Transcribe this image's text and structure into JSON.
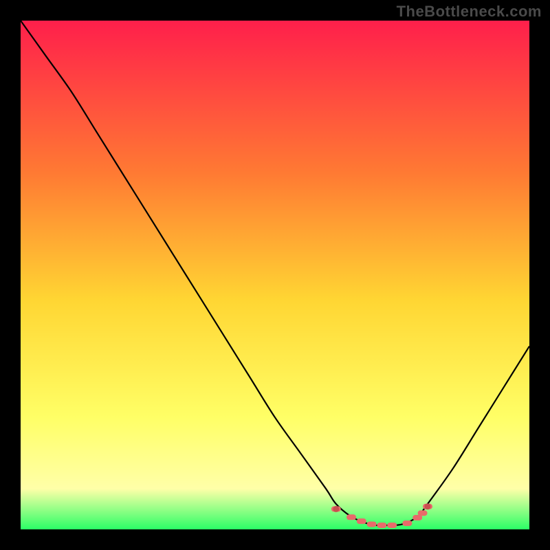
{
  "watermark": "TheBottleneck.com",
  "colors": {
    "frame": "#000000",
    "curve": "#000000",
    "markers": "#e86a6a",
    "grad_top": "#ff1f4b",
    "grad_mid1": "#ff7a33",
    "grad_mid2": "#ffd633",
    "grad_mid3": "#ffff66",
    "grad_low": "#ffffa8",
    "grad_bottom": "#2bff66"
  },
  "chart_data": {
    "type": "line",
    "title": "",
    "xlabel": "",
    "ylabel": "",
    "xlim": [
      0,
      100
    ],
    "ylim": [
      0,
      100
    ],
    "curve": {
      "x": [
        0,
        5,
        10,
        15,
        20,
        25,
        30,
        35,
        40,
        45,
        50,
        55,
        60,
        62,
        65,
        68,
        70,
        72,
        75,
        78,
        80,
        85,
        90,
        95,
        100
      ],
      "y": [
        100,
        93,
        86,
        78,
        70,
        62,
        54,
        46,
        38,
        30,
        22,
        15,
        8,
        5,
        2.5,
        1.2,
        0.8,
        0.8,
        1.0,
        2.5,
        5,
        12,
        20,
        28,
        36
      ]
    },
    "markers": {
      "x": [
        62,
        65,
        67,
        69,
        71,
        73,
        76,
        78,
        79,
        80
      ],
      "y": [
        4.0,
        2.4,
        1.6,
        1.0,
        0.8,
        0.8,
        1.2,
        2.3,
        3.2,
        4.5
      ]
    }
  }
}
